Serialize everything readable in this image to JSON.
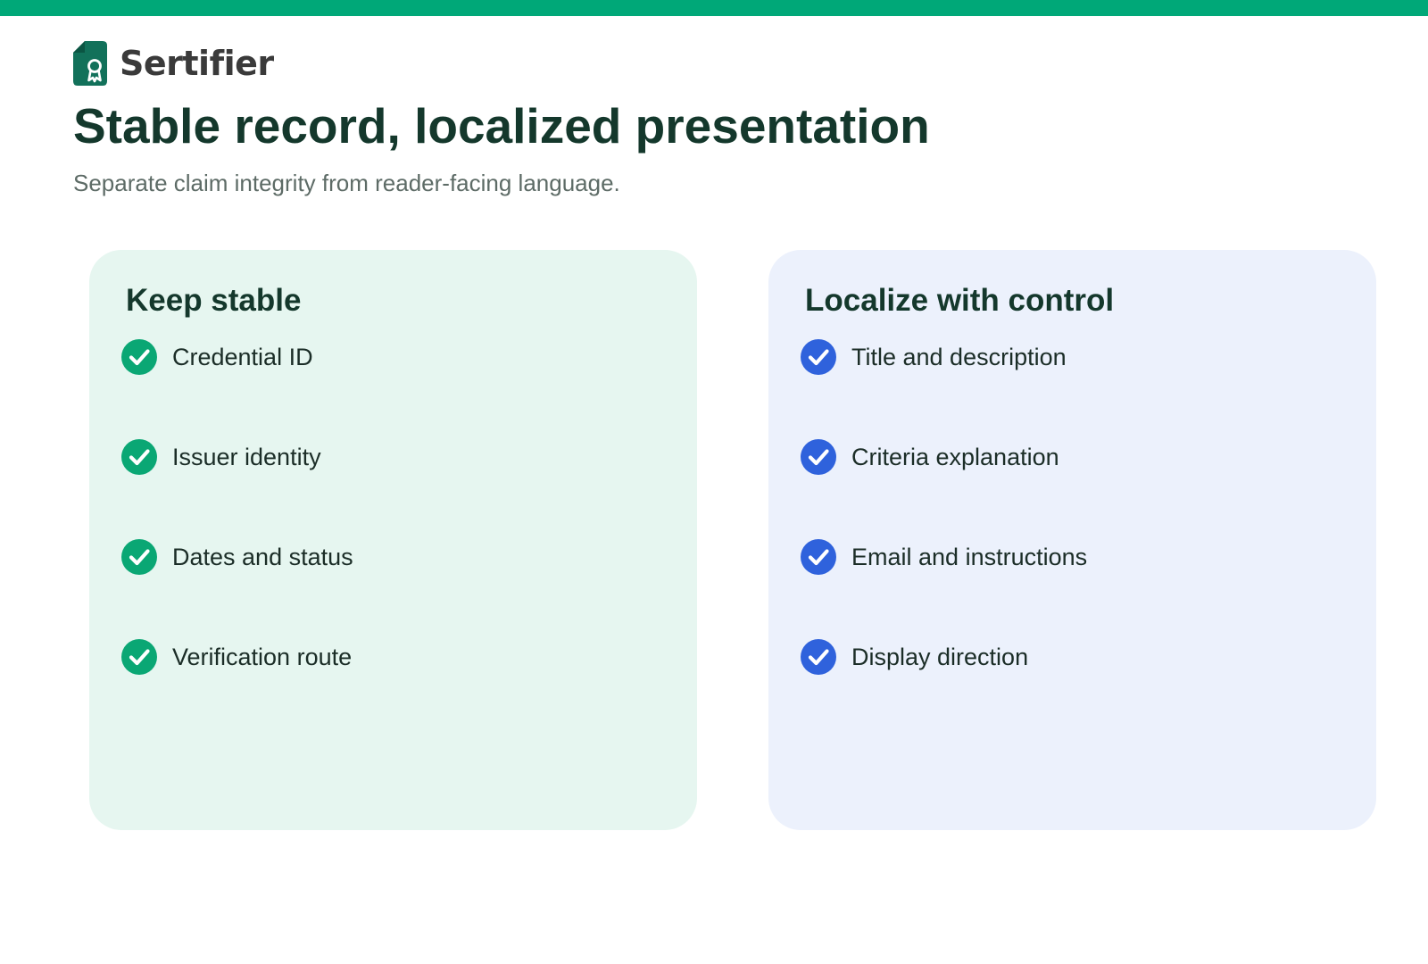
{
  "brand": {
    "name": "Sertifier",
    "accent_color": "#00a878",
    "logo_color": "#12715a"
  },
  "header": {
    "title": "Stable record, localized presentation",
    "subtitle": "Separate claim integrity from reader-facing language."
  },
  "cards": [
    {
      "title": "Keep stable",
      "icon": "check-circle-icon",
      "icon_color": "#0aa774",
      "background": "#e6f6f0",
      "items": [
        "Credential ID",
        "Issuer identity",
        "Dates and status",
        "Verification route"
      ]
    },
    {
      "title": "Localize with control",
      "icon": "check-circle-icon",
      "icon_color": "#2f62dc",
      "background": "#ecf1fc",
      "items": [
        "Title and description",
        "Criteria explanation",
        "Email and instructions",
        "Display direction"
      ]
    }
  ]
}
